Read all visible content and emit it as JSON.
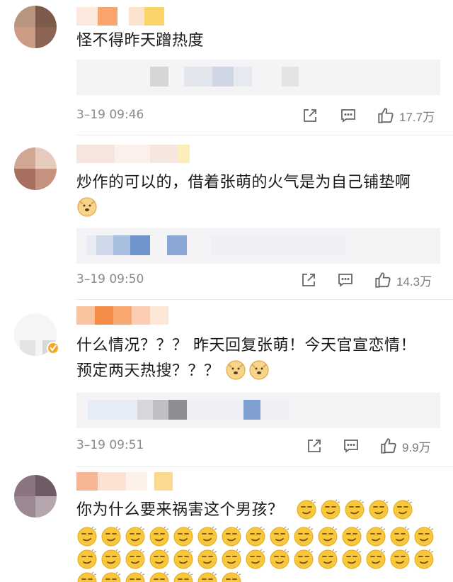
{
  "comments": [
    {
      "text": "怪不得昨天蹭热度",
      "time": "3–19 09:46",
      "likes": "17.7万"
    },
    {
      "text_line1": "炒作的可以的，借着张萌的火气是为自己铺垫啊",
      "time": "3–19 09:50",
      "likes": "14.3万"
    },
    {
      "text_line1": "什么情况？？？ 昨天回复张萌！今天官宣恋情！",
      "text_line2": "预定两天热搜？？？",
      "time": "3–19 09:51",
      "likes": "9.9万"
    },
    {
      "text_line1": "你为什么要来祸害这个男孩？"
    }
  ],
  "icons": {
    "share": "share-icon",
    "comment": "comment-icon",
    "like": "thumbs-up-icon",
    "doge": "doge-emoji-icon",
    "smirk": "smirk-emoji-icon"
  },
  "colors": {
    "meta_text": "#8a8a8a",
    "reply_bg": "#f4f4f6",
    "emoji_yellow": "#f7c83c"
  }
}
